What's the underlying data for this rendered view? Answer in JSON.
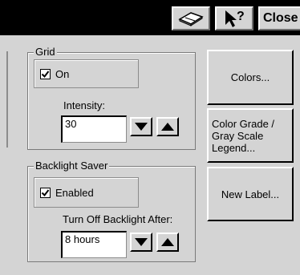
{
  "titlebar": {
    "book_icon": "book-icon",
    "help_icon": "help-pointer-icon",
    "close_label": "Close"
  },
  "grid": {
    "legend": "Grid",
    "on_label": "On",
    "on_checked": true,
    "intensity_label": "Intensity:",
    "intensity_value": "30"
  },
  "backlight": {
    "legend": "Backlight Saver",
    "enabled_label": "Enabled",
    "enabled_checked": true,
    "turn_off_label": "Turn Off Backlight After:",
    "turn_off_value": "8 hours"
  },
  "buttons": {
    "colors": "Colors...",
    "color_grade": "Color Grade /\nGray Scale\nLegend...",
    "new_label": "New Label..."
  },
  "icons": {
    "down_arrow": "down-arrow-icon",
    "up_arrow": "up-arrow-icon",
    "check": "check-icon"
  }
}
